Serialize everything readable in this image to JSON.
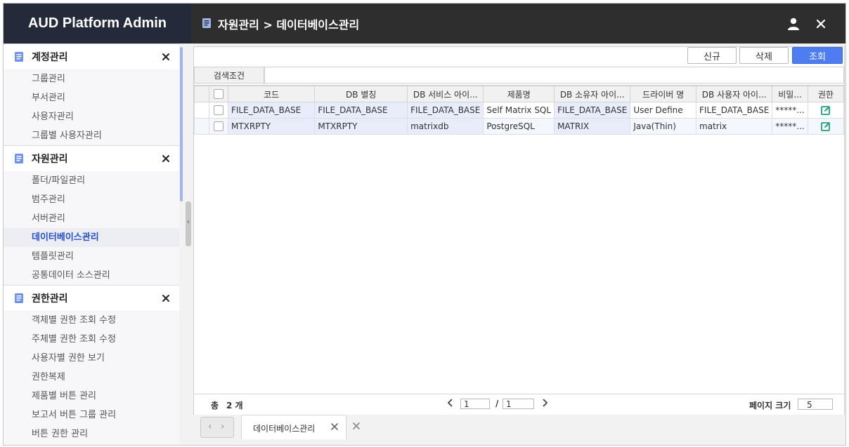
{
  "brand": "AUD Platform Admin",
  "header": {
    "breadcrumb": "자원관리 > 데이터베이스관리"
  },
  "sidebar": {
    "sections": [
      {
        "title": "계정관리",
        "items": [
          "그룹관리",
          "부서관리",
          "사용자관리",
          "그룹별 사용자관리"
        ]
      },
      {
        "title": "자원관리",
        "items": [
          "폴더/파일관리",
          "범주관리",
          "서버관리",
          "데이터베이스관리",
          "템플릿관리",
          "공통데이터 소스관리"
        ],
        "active": "데이터베이스관리"
      },
      {
        "title": "권한관리",
        "items": [
          "객체별 권한 조회 수정",
          "주체별 권한 조회 수정",
          "사용자별 권한 보기",
          "권한복제",
          "제품별 버튼 관리",
          "보고서 버튼 그룹 관리",
          "버튼 권한 관리"
        ]
      }
    ]
  },
  "toolbar": {
    "new_label": "신규",
    "delete_label": "삭제",
    "search_label": "조회"
  },
  "search": {
    "label": "검색조건",
    "value": ""
  },
  "grid": {
    "columns": [
      "코드",
      "DB 별칭",
      "DB 서비스 아이...",
      "제품명",
      "DB 소유자 아이...",
      "드라이버 명",
      "DB 사용자 아이...",
      "비밀...",
      "권한"
    ],
    "rows": [
      [
        "FILE_DATA_BASE",
        "FILE_DATA_BASE",
        "FILE_DATA_BASE",
        "Self Matrix SQL",
        "FILE_DATA_BASE",
        "User Define",
        "FILE_DATA_BASE",
        "*****..."
      ],
      [
        "MTXRPTY",
        "MTXRPTY",
        "matrixdb",
        "PostgreSQL",
        "MATRIX",
        "Java(Thin)",
        "matrix",
        "*****..."
      ]
    ]
  },
  "footer": {
    "total_label": "총",
    "count": "2 개",
    "page_current": "1",
    "page_sep": "/",
    "page_total": "1",
    "page_size_label": "페이지 크기",
    "page_size": "5"
  },
  "tabs": [
    {
      "label": "데이터베이스관리"
    }
  ],
  "colors": {
    "brand_bg": "#242a3a",
    "topbar_bg": "#2e2e2e",
    "accent": "#4e7df2",
    "active_text": "#2650c8",
    "edit_icon": "#1aa37a"
  }
}
